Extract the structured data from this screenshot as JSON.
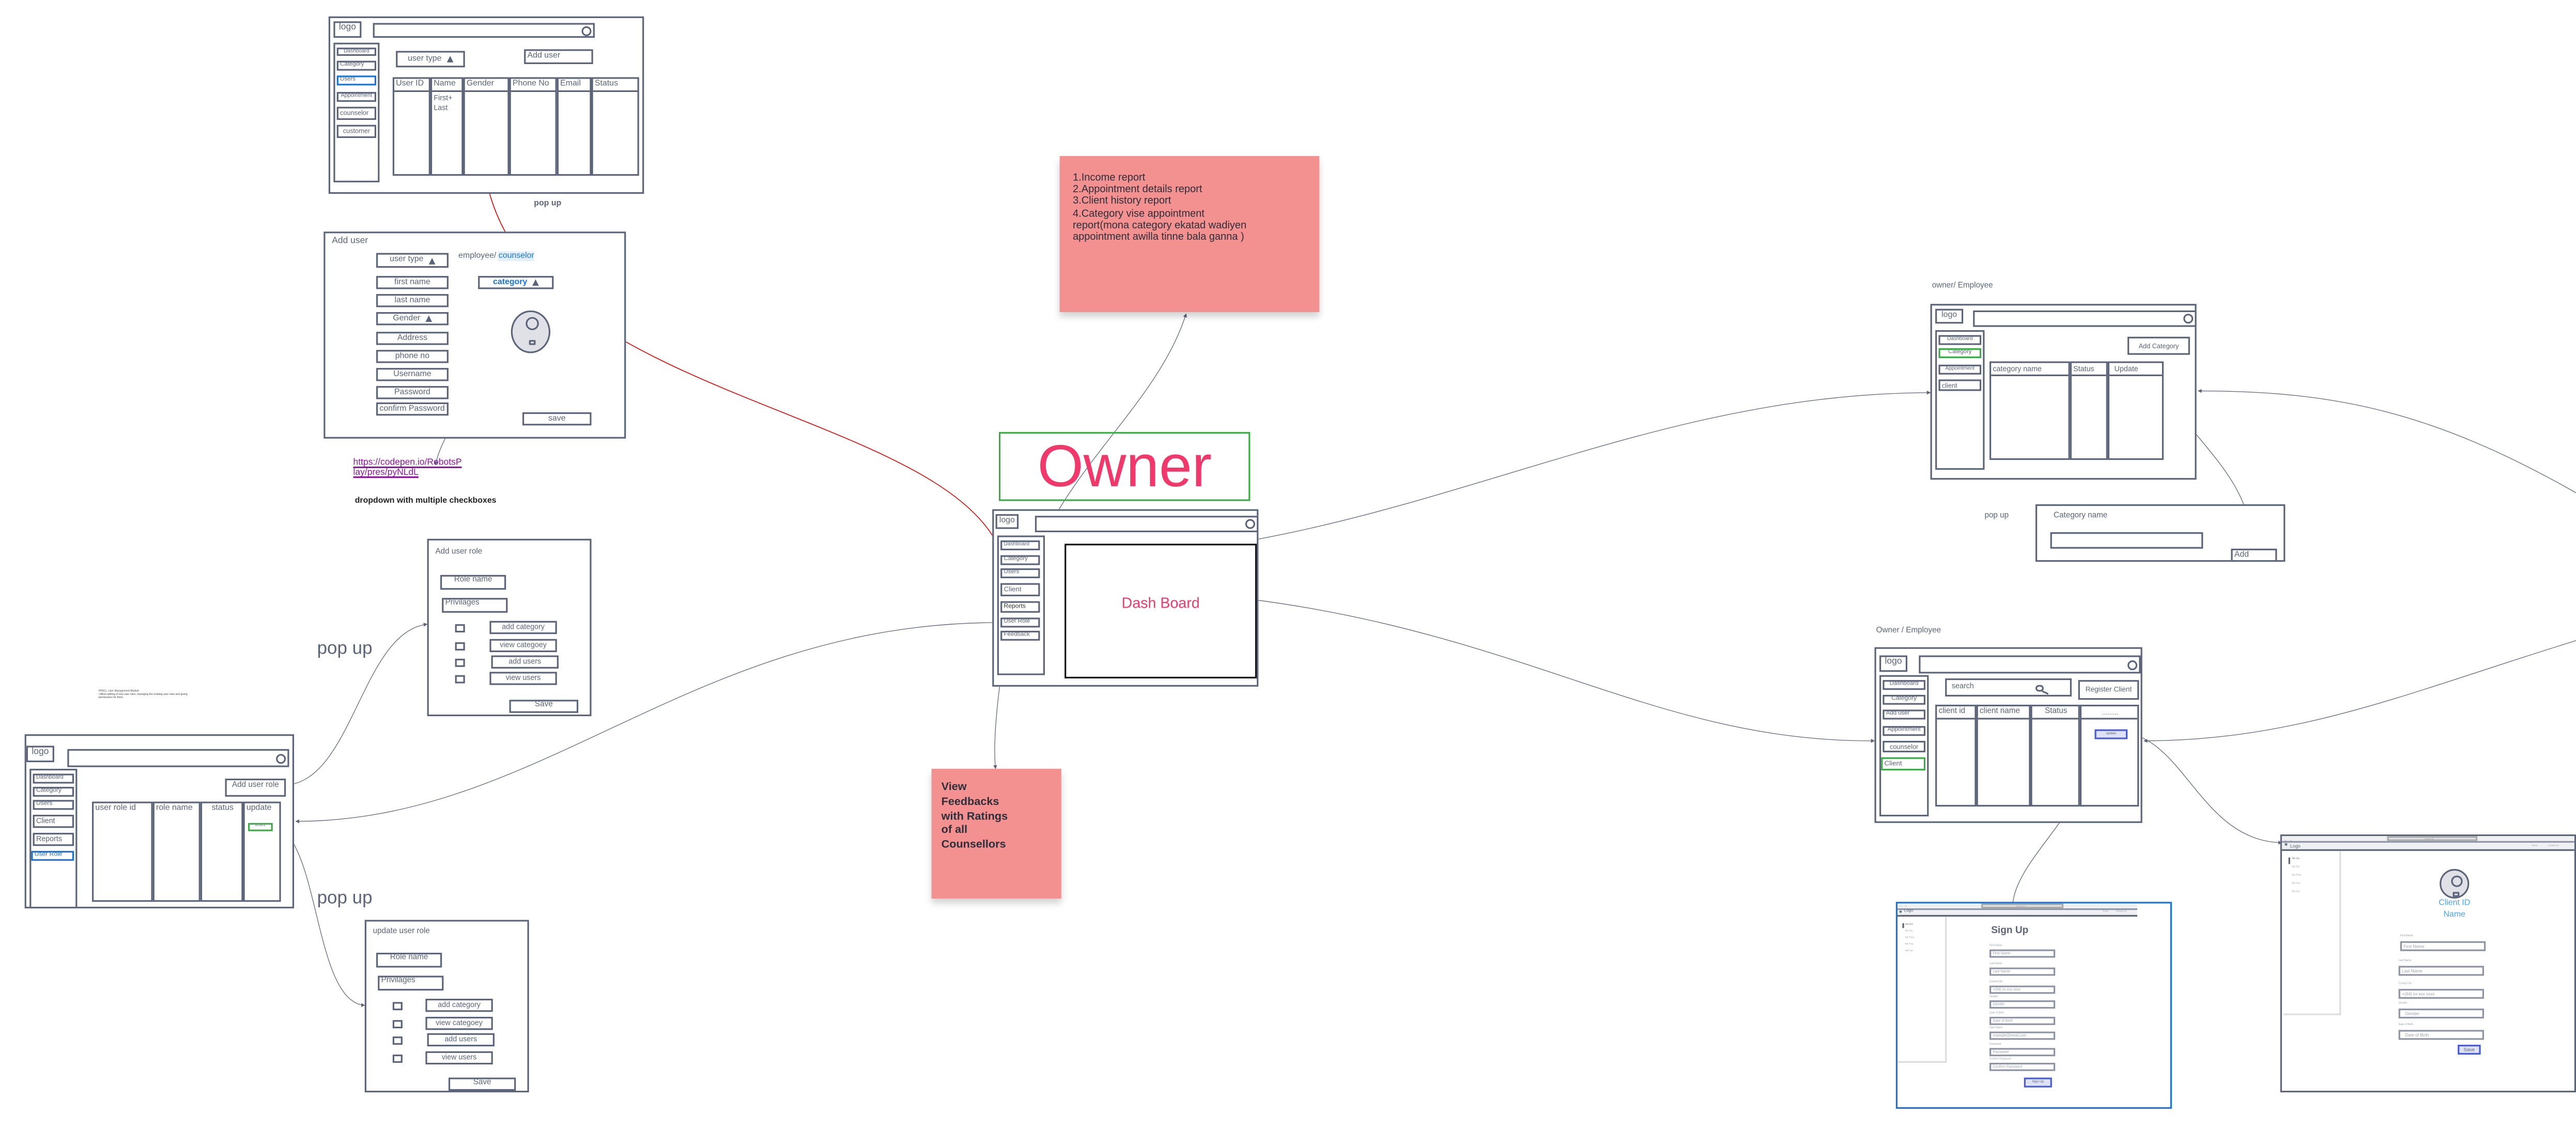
{
  "colors": {
    "line": "#5b6479",
    "accent_red": "#e30000",
    "owner_pink": "#f0386b",
    "note_pink": "#f39090",
    "active_blue": "#1a73d9",
    "active_green": "#3daa48",
    "profile_blue": "#4aa3f0"
  },
  "users_screen": {
    "logo": "logo",
    "sidebar": [
      "Dashboard",
      "Category",
      "Users",
      "Appointment",
      "counselor",
      "customer"
    ],
    "user_type": "user type",
    "add_user": "Add user",
    "columns": [
      "User ID",
      "Name",
      "Gender",
      "Phone No",
      "Email",
      "Status"
    ],
    "name_cell": [
      "First+",
      "Last"
    ]
  },
  "popup_labels": {
    "users": "pop up",
    "add_role": "pop up",
    "update_role": "pop up",
    "category": "pop up"
  },
  "add_user_popup": {
    "title": "Add user",
    "user_type": "user type",
    "type_note": "employee/ ",
    "type_note_highlight": "counselor",
    "fields": [
      "first name",
      "last name",
      "Gender",
      "Address",
      "phone no",
      "Username",
      "Password",
      "confirm Password"
    ],
    "category": "category",
    "save": "save"
  },
  "link": {
    "line1": "https://codepen.io/RobotsP",
    "line2": "lay/pres/pyNLdL",
    "note": "dropdown with multiple checkboxes"
  },
  "add_role_popup": {
    "title": "Add user role",
    "role_name": "Role name",
    "privileges": "Privilages",
    "options": [
      "add category",
      "view categoey",
      "add users",
      "view users"
    ],
    "save": "Save"
  },
  "update_role_popup": {
    "title": "update user role",
    "role_name": "Role name",
    "privileges": "Privilages",
    "options": [
      "add category",
      "view categoey",
      "add users",
      "view users"
    ],
    "save": "Save"
  },
  "frn": {
    "title": "FRN11: User Management Module",
    "body": "• Allow adding of new user roles, managing the existing user roles and giving",
    "body2": "permissions for them."
  },
  "user_role_screen": {
    "logo": "logo",
    "sidebar": [
      "Dashboard",
      "Category",
      "Users",
      "Client",
      "Reports",
      "User Role"
    ],
    "add_button": "Add user role",
    "columns": [
      "user role id",
      "role name",
      "status",
      "update"
    ],
    "update_button": "UPDATE"
  },
  "owner": {
    "title": "Owner",
    "logo": "logo",
    "sidebar": [
      "Dashboard",
      "Category",
      "Users",
      "Client",
      "Reports",
      "User Role",
      "Feedback"
    ],
    "dashboard": "Dash Board"
  },
  "reports_note": {
    "lines": [
      "1.Income report",
      "2.Appointment details report",
      "3.Client history report",
      "4.Category vise appointment",
      "report(mona category ekatad wadiyen",
      "appointment awilla tinne bala ganna )"
    ]
  },
  "feedback_note": {
    "lines": [
      "View",
      "Feedbacks",
      "with Ratings",
      "of all",
      "Counsellors"
    ]
  },
  "category_screen": {
    "heading": "owner/ Employee",
    "logo": "logo",
    "sidebar": [
      "Dashboard",
      "Category",
      "Appointment",
      "client"
    ],
    "add_button": "Add Category",
    "columns": [
      "category name",
      "Status",
      "Update"
    ]
  },
  "category_popup": {
    "label": "Category name",
    "add": "Add"
  },
  "client_screen": {
    "heading": "Owner / Employee",
    "logo": "logo",
    "sidebar": [
      "Dashboard",
      "Category",
      "Add user",
      "Appointment",
      "counselor",
      "Client"
    ],
    "search_placeholder": "search",
    "register_button": "Register Client",
    "columns": [
      "client id",
      "client name",
      "Status",
      "........."
    ],
    "update_button": "update"
  },
  "signup_screen": {
    "url": "website.com",
    "logo": "Logo",
    "nav": [
      "Home",
      "Contact Us"
    ],
    "tabs": [
      "Tab One",
      "Tab Two",
      "Tab Three",
      "Tab Four",
      "Tab Five"
    ],
    "title": "Sign Up",
    "fields": [
      {
        "label": "First Name",
        "placeholder": "First Name"
      },
      {
        "label": "Last Name",
        "placeholder": "Last Name"
      },
      {
        "label": "Contact No",
        "placeholder": "+(94) xx xxx xxxx"
      },
      {
        "label": "Gender",
        "placeholder": "Gender"
      },
      {
        "label": "Date of Birth",
        "placeholder": "Date of Birth"
      },
      {
        "label": "User Name",
        "placeholder": "example@email.com"
      },
      {
        "label": "Password",
        "placeholder": "Password"
      },
      {
        "label": "Confirm Password",
        "placeholder": "Confirm Password"
      }
    ],
    "submit": "Sign Up"
  },
  "profile_screen": {
    "url": "website.com",
    "logo": "Logo",
    "nav": [
      "Home",
      "Contact Us"
    ],
    "tabs": [
      "Tab One",
      "Tab Two",
      "Tab Three",
      "Tab Four",
      "Tab Five"
    ],
    "client_id": "Client ID",
    "name": "Name",
    "fields": [
      {
        "label": "First Name",
        "placeholder": "First Name"
      },
      {
        "label": "Last Name",
        "placeholder": "Last Name"
      },
      {
        "label": "Contact No",
        "placeholder": "+(94) xx xxx xxxx"
      },
      {
        "label": "Gender",
        "placeholder": "Gender"
      },
      {
        "label": "Date of Birth",
        "placeholder": "Date of Birth"
      }
    ],
    "save": "Save"
  }
}
